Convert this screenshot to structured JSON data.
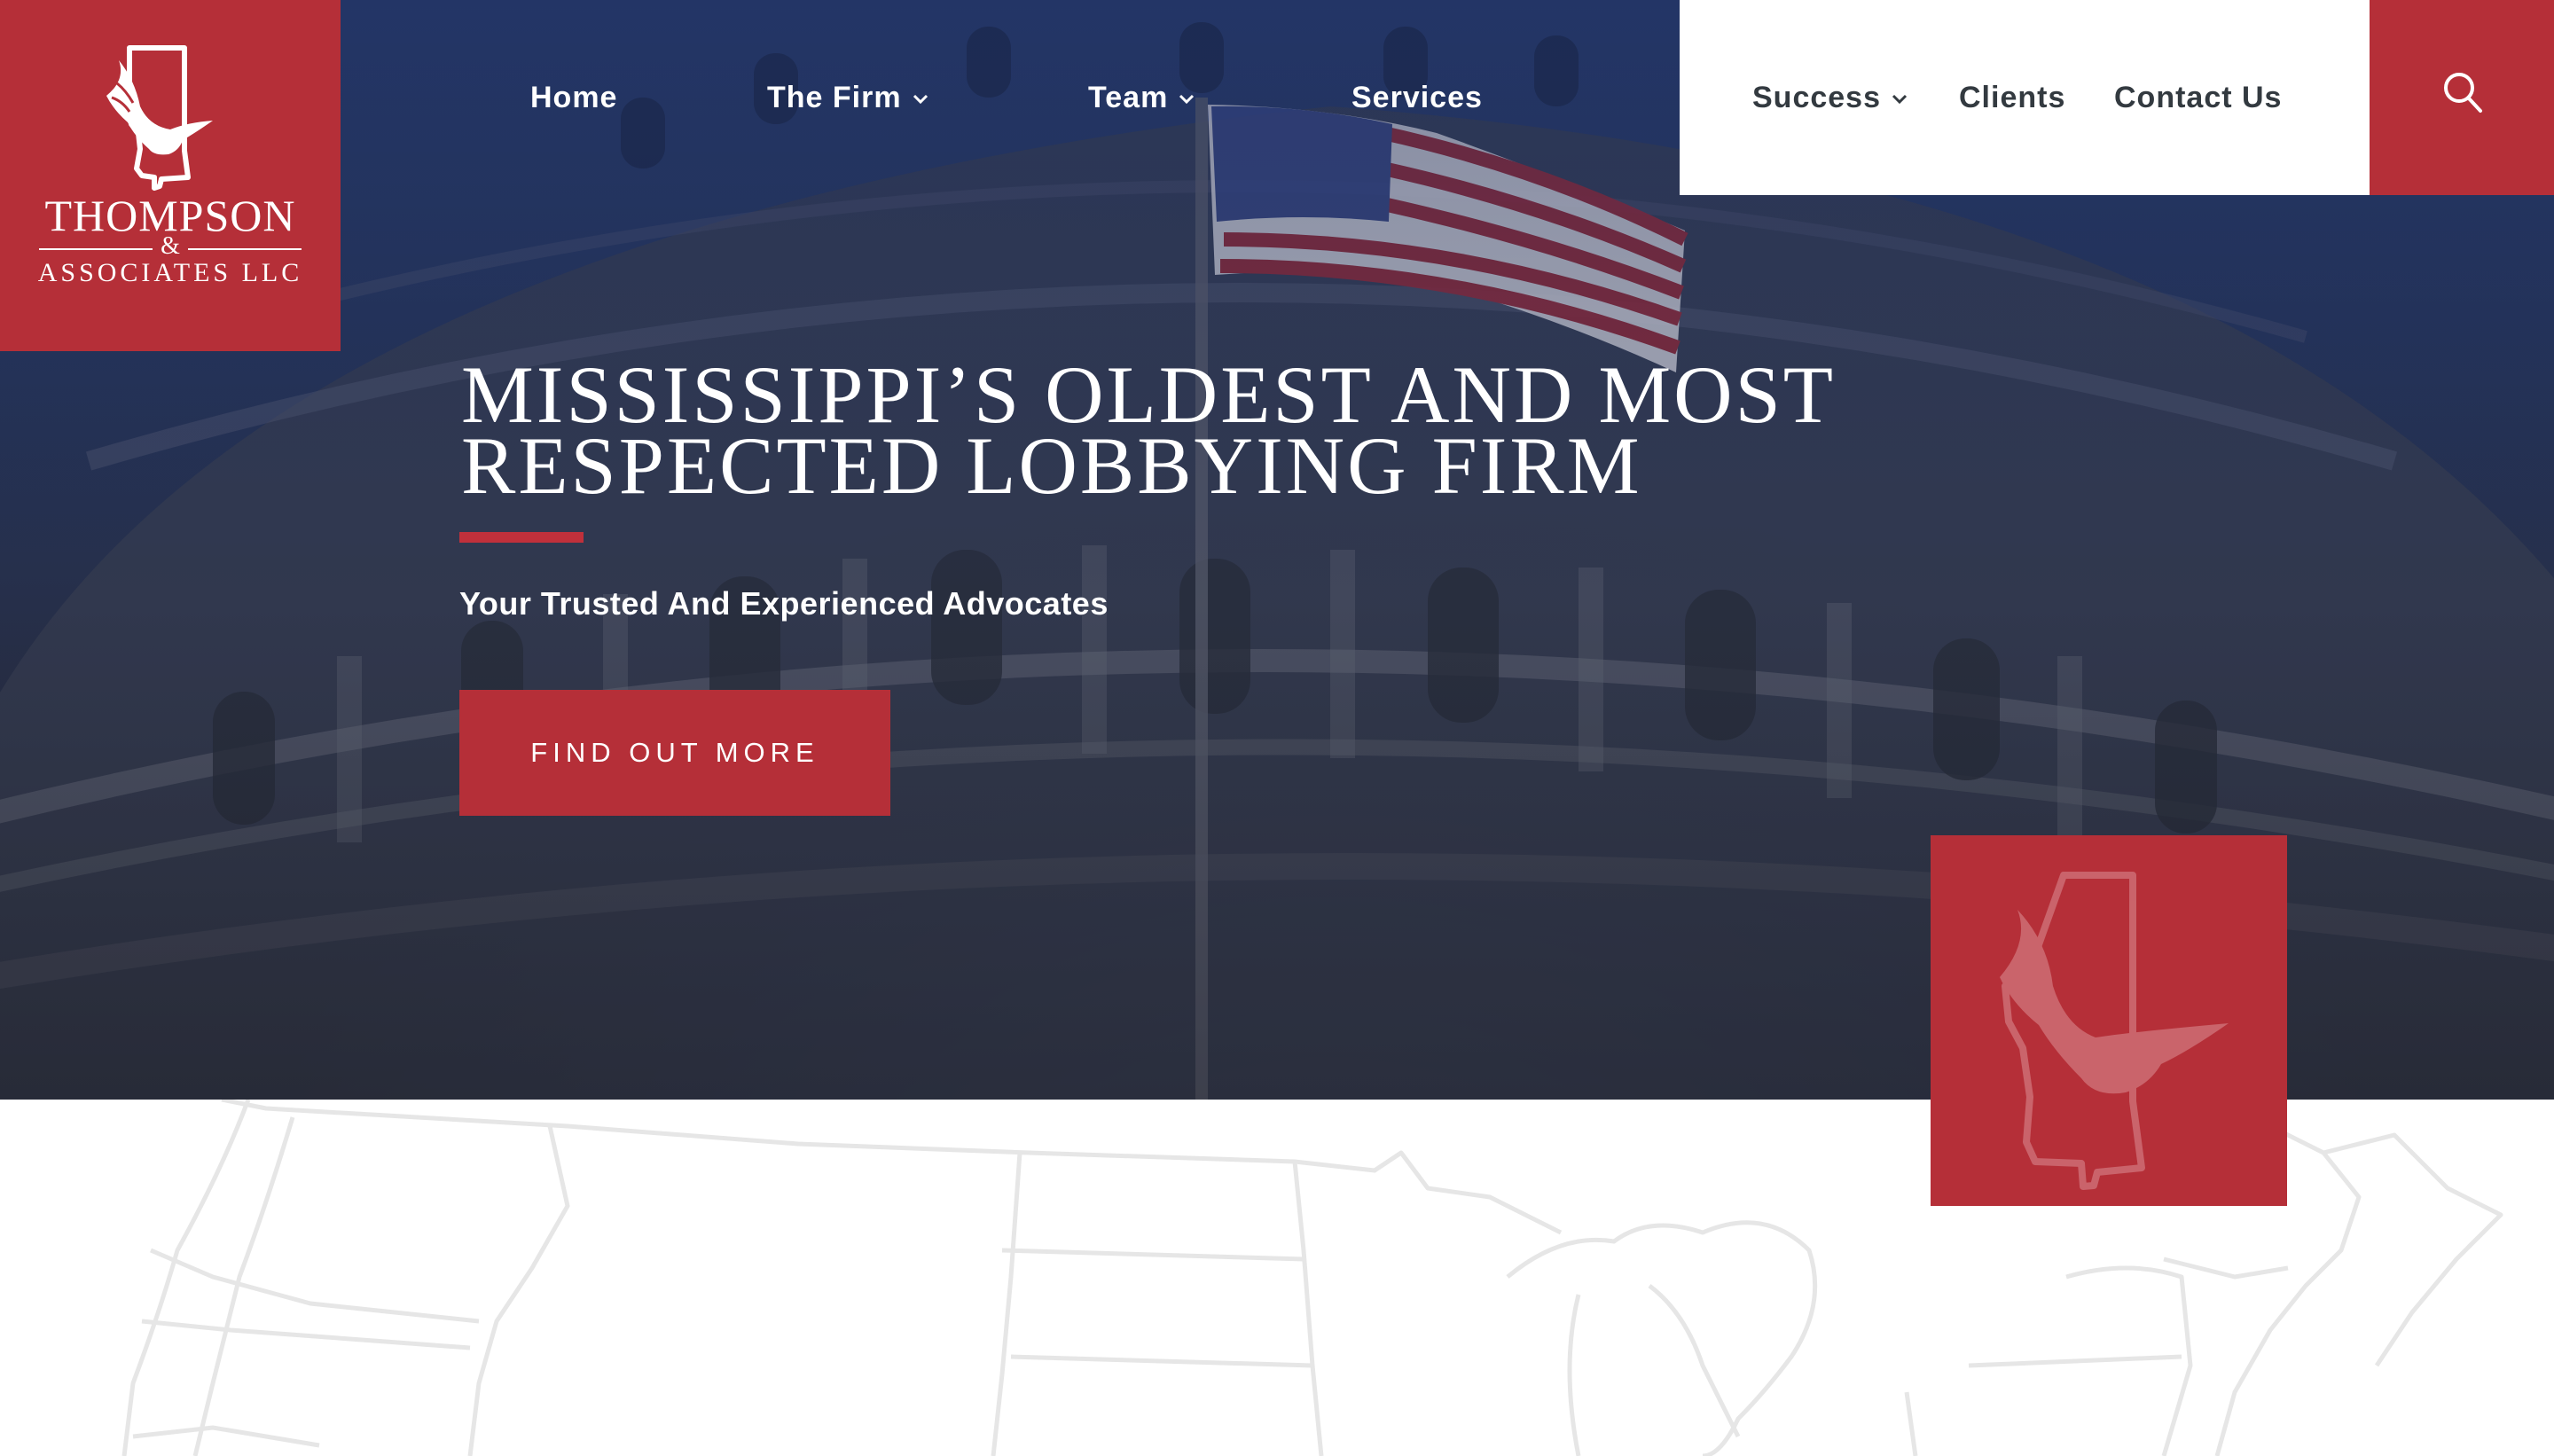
{
  "logo": {
    "name": "THOMPSON",
    "amp": "&",
    "sub": "ASSOCIATES LLC",
    "icon": "mississippi-eagle-icon"
  },
  "nav": {
    "items": [
      {
        "label": "Home",
        "dropdown": false
      },
      {
        "label": "The Firm",
        "dropdown": true
      },
      {
        "label": "Team",
        "dropdown": true
      },
      {
        "label": "Services",
        "dropdown": false
      },
      {
        "label": "Success",
        "dropdown": true
      },
      {
        "label": "Clients",
        "dropdown": false
      },
      {
        "label": "Contact Us",
        "dropdown": false
      }
    ],
    "search_icon": "search-icon"
  },
  "hero": {
    "title_line1": "Mississippi’s Oldest and Most",
    "title_line2": "Respected Lobbying Firm",
    "subtitle": "Your Trusted And Experienced Advocates",
    "cta_label": "FIND OUT MORE"
  },
  "colors": {
    "brand_red": "#b52f38",
    "hero_navy": "#2b3f72",
    "nav_dark_text": "#333a40",
    "map_line": "#e6e6e6"
  },
  "decor": {
    "emblem_icon": "mississippi-eagle-icon",
    "map": "us-states-outline-map"
  }
}
